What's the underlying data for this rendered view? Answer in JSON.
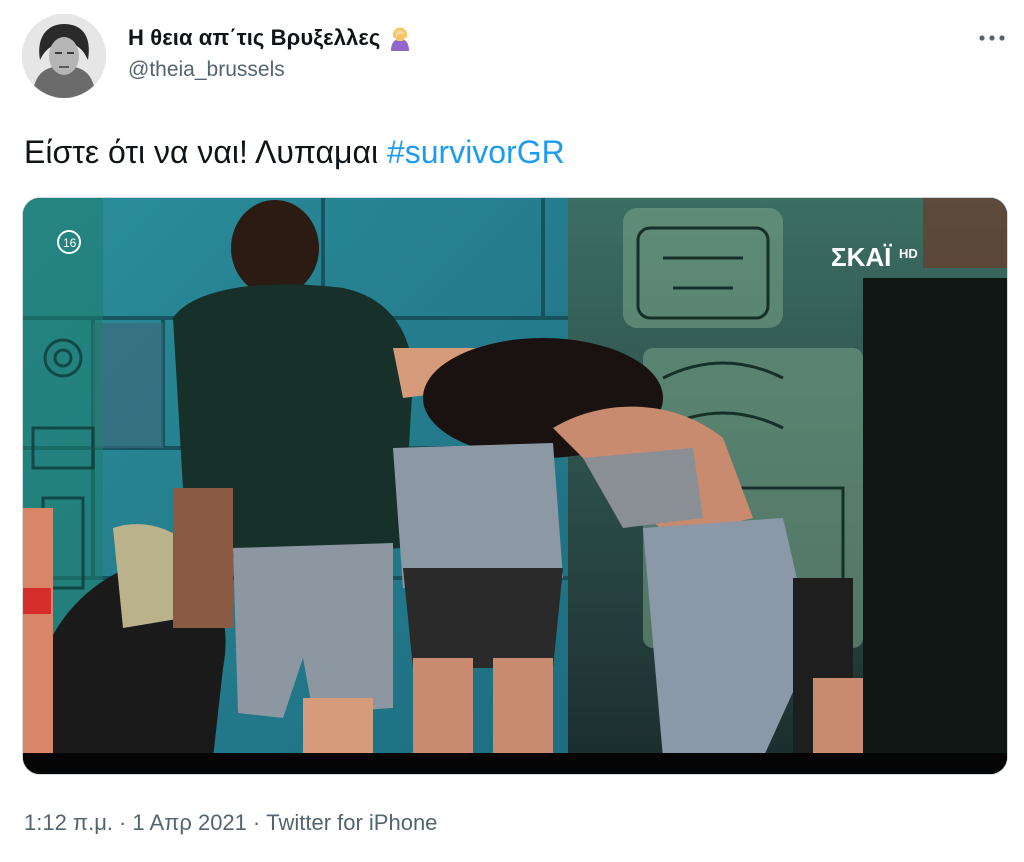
{
  "author": {
    "display_name": "Η θεια απ΄τις Βρυξελλες",
    "name_emoji": "woman-facepalming-emoji",
    "handle": "@theia_brussels",
    "avatar": "profile-photo-black-and-white"
  },
  "tweet": {
    "text": "Είστε ότι να ναι! Λυπαμαι",
    "hashtag": "#survivorGR"
  },
  "media": {
    "description_icon": "tv-screen-photo",
    "channel_logo": "ΣΚΑΪ",
    "channel_logo_hd": "HD",
    "corner_badge": "16"
  },
  "meta": {
    "time": "1:12 π.μ.",
    "separator": "·",
    "date": "1 Απρ 2021",
    "source": "Twitter for iPhone"
  },
  "colors": {
    "link": "#1d9bf0",
    "secondary_text": "#536471",
    "primary_text": "#0f1419"
  }
}
